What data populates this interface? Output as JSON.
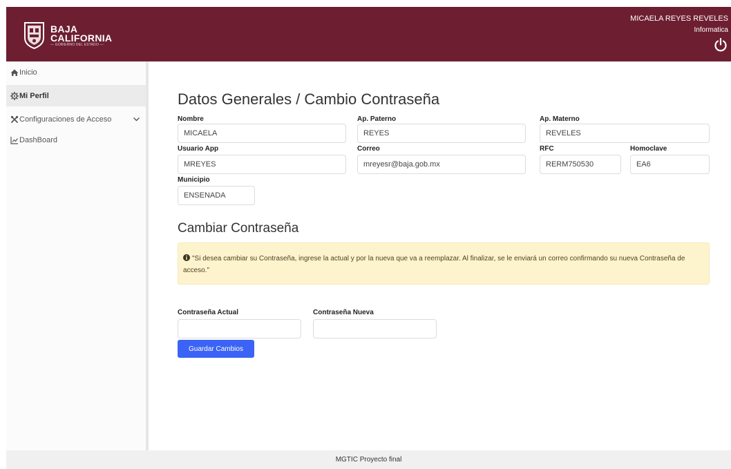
{
  "header": {
    "brand_line1": "BAJA",
    "brand_line2": "CALIFORNIA",
    "brand_sub": "— GOBIERNO DEL ESTADO —",
    "user_name": "MICAELA REYES REVELES",
    "user_dept": "Informatica",
    "power_icon": "power-icon",
    "bg_color": "#6d1f31"
  },
  "sidebar": {
    "items": [
      {
        "label": "Inicio",
        "icon": "home-icon"
      },
      {
        "label": "Mi Perfil",
        "icon": "gear-icon",
        "active": true
      },
      {
        "label": "Configuraciones de Acceso",
        "icon": "settings-icon",
        "chevron": "chevron-down-icon"
      },
      {
        "label": "DashBoard",
        "icon": "chart-icon"
      }
    ]
  },
  "profile": {
    "title": "Datos Generales / Cambio Contraseña",
    "nombre_label": "Nombre",
    "nombre_value": "MICAELA",
    "paterno_label": "Ap. Paterno",
    "paterno_value": "REYES",
    "materno_label": "Ap. Materno",
    "materno_value": "REVELES",
    "usuario_label": "Usuario App",
    "usuario_value": "MREYES",
    "correo_label": "Correo",
    "correo_value": "mreyesr@baja.gob.mx",
    "rfc_label": "RFC",
    "rfc_value": "RERM750530",
    "homoclave_label": "Homoclave",
    "homoclave_value": "EA6",
    "municipio_label": "Municipio",
    "municipio_value": "ENSENADA"
  },
  "password": {
    "title": "Cambiar Contraseña",
    "alert_text": "\"Si desea cambiar su Contraseña, ingrese la actual y por la nueva que va a reemplazar. Al finalizar, se le enviará un correo confirmando su nueva Contraseña de acceso.\"",
    "alert_color": "#fdf3cd",
    "current_label": "Contraseña Actual",
    "current_value": "",
    "new_label": "Contraseña Nueva",
    "new_value": "",
    "save_label": "Guardar Cambios",
    "save_color": "#3b63f5"
  },
  "footer": {
    "text": "MGTIC Proyecto final"
  }
}
